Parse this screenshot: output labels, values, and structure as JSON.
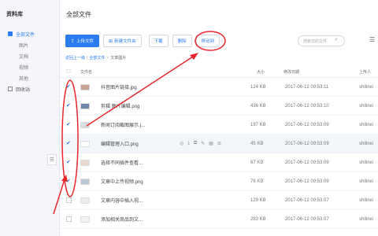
{
  "sidebar": {
    "logo": "资料库",
    "items": [
      {
        "label": "全部文件",
        "active": true
      },
      {
        "label": "图片"
      },
      {
        "label": "文档"
      },
      {
        "label": "视频"
      },
      {
        "label": "其他"
      },
      {
        "label": "回收站"
      }
    ],
    "collapse": "☰"
  },
  "header": {
    "title": "全部文件"
  },
  "toolbar": {
    "upload": "上传文件",
    "new_folder": "新建文件夹",
    "download": "下载",
    "delete": "删除",
    "move": "移动到"
  },
  "search": {
    "placeholder": "搜索您的文件"
  },
  "breadcrumb": {
    "back": "返回上一级",
    "root": "全部文件",
    "current": "文章图片"
  },
  "table": {
    "headers": {
      "name": "文件名",
      "size": "大小",
      "date": "修改日期",
      "user": "上传人"
    },
    "rows": [
      {
        "name": "抖音图片链接.jpg",
        "size": "124 KB",
        "date": "2017-06-12 09:53:11",
        "user": "shilinxi",
        "checked": true
      },
      {
        "name": "剪辑 图片编辑.png",
        "size": "436 KB",
        "date": "2017-06-12 09:53:10",
        "user": "shilinxi",
        "checked": true
      },
      {
        "name": "新闻订阅截图展示.j...",
        "size": "197 KB",
        "date": "2017-06-12 09:53:09",
        "user": "shilinxi",
        "checked": true
      },
      {
        "name": "编辑管理入口.png",
        "size": "45 KB",
        "date": "2017-06-12 09:53:09",
        "user": "shilinxi",
        "checked": true,
        "hover": true
      },
      {
        "name": "选择不同插件查看...",
        "size": "67 KB",
        "date": "2017-06-12 09:53:09",
        "user": "shilinxi",
        "checked": true
      },
      {
        "name": "文章中上传视频.png",
        "size": "76 KB",
        "date": "2017-06-12 09:53:09",
        "user": "shilinxi",
        "checked": true
      },
      {
        "name": "文章内容中插入视...",
        "size": "129 KB",
        "date": "2017-06-12 09:53:07",
        "user": "shilinxi",
        "checked": false
      },
      {
        "name": "添加相关商品到文...",
        "size": "283 KB",
        "date": "2017-06-12 09:53:07",
        "user": "shilinxi",
        "checked": false
      }
    ],
    "row_actions": [
      "◎",
      "⤓",
      "⧉",
      "✎",
      "▤",
      "⊘"
    ]
  },
  "colors": {
    "accent": "#2b7cf0",
    "annotation": "#e8262d"
  }
}
